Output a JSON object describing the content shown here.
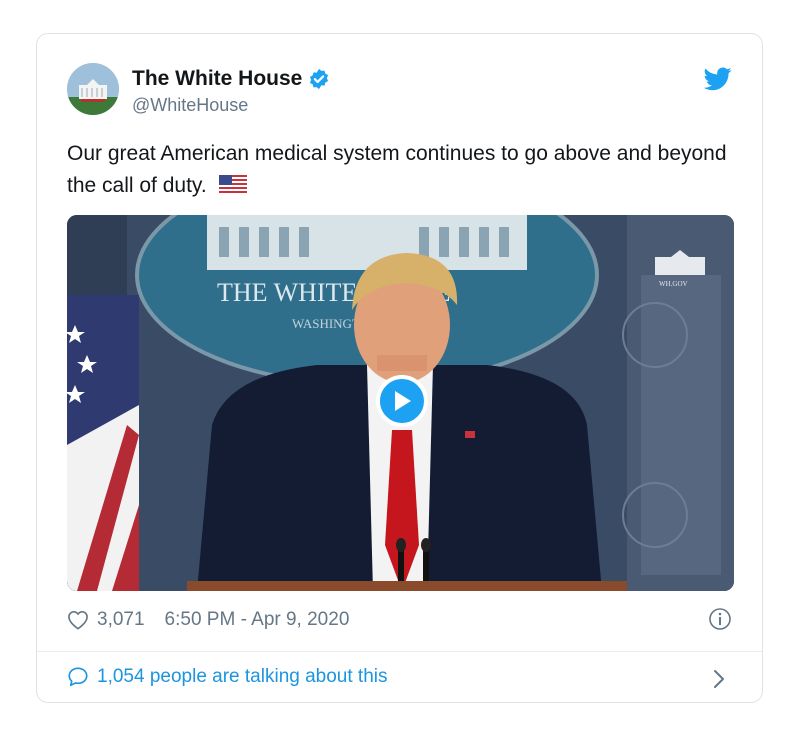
{
  "tweet": {
    "author_name": "The White House",
    "author_handle": "@WhiteHouse",
    "text": "Our great American medical system continues to go above and beyond the call of duty.",
    "video": {
      "seal_text": "THE WHITE HOUSE",
      "seal_subtext": "WASHINGTON",
      "watermark": "WH.GOV"
    },
    "likes": "3,071",
    "timestamp": "6:50 PM - Apr 9, 2020",
    "talking": "1,054 people are talking about this"
  },
  "colors": {
    "accent": "#1da1f2",
    "link": "#1b95e0",
    "secondary_text": "#657786",
    "primary_text": "#14171a"
  },
  "icons": [
    "verified-badge-icon",
    "twitter-bird-icon",
    "us-flag-icon",
    "play-icon",
    "heart-icon",
    "info-icon",
    "speech-bubble-icon",
    "chevron-right-icon"
  ]
}
